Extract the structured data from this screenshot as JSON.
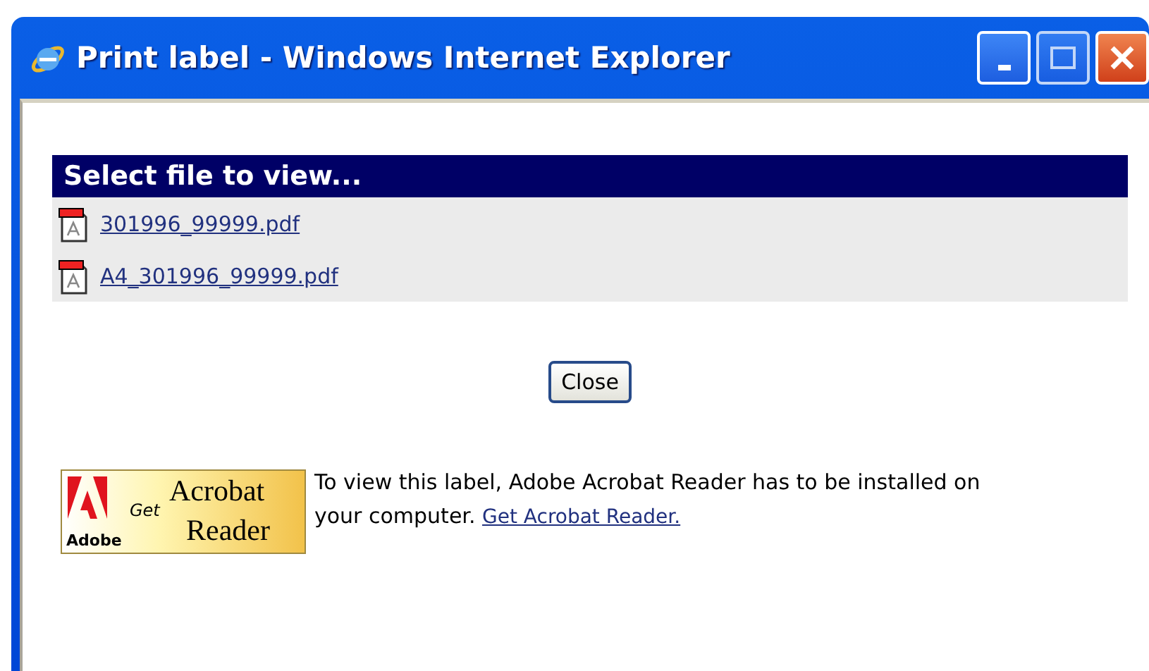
{
  "window": {
    "title": "Print label - Windows Internet Explorer"
  },
  "file_list": {
    "heading": "Select file to view...",
    "files": [
      {
        "name": "301996_99999.pdf"
      },
      {
        "name": "A4_301996_99999.pdf"
      }
    ]
  },
  "close_button": "Close",
  "acrobat_badge": {
    "brand": "Adobe",
    "get": "Get",
    "product_1": "Acrobat",
    "product_2": "Reader"
  },
  "notice": {
    "text": "To view this label, Adobe Acrobat Reader has to be installed on your computer.",
    "link": "Get Acrobat Reader."
  }
}
